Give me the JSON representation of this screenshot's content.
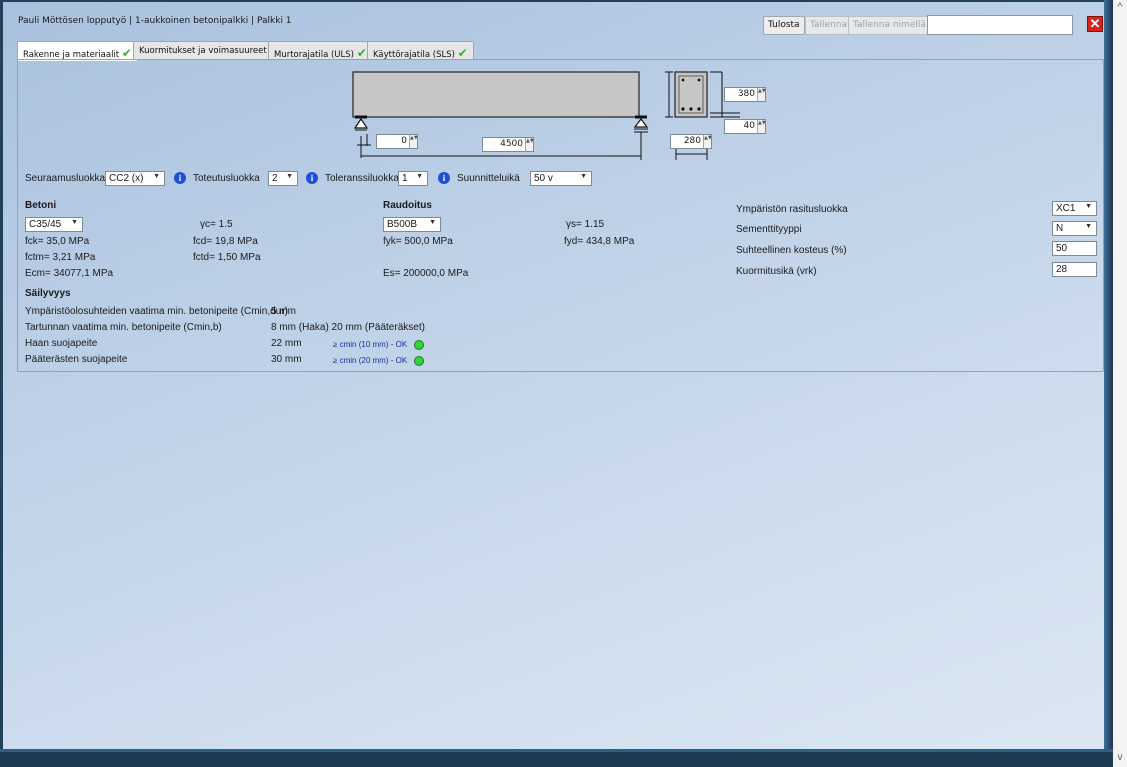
{
  "window": {
    "title": "Pauli Möttösen lopputyö | 1-aukkoinen betonipalkki | Palkki 1",
    "buttons": {
      "print": "Tulosta",
      "save": "Tallenna",
      "save_as": "Tallenna nimellä"
    },
    "search_value": "",
    "close_icon": "close-icon",
    "scroll_up": "^",
    "scroll_down": "v"
  },
  "tabs": [
    {
      "label": "Rakenne ja materiaalit",
      "status": "✔",
      "active": true
    },
    {
      "label": "Kuormitukset ja voimasuureet",
      "status": ""
    },
    {
      "label": "Murtorajatila (ULS)",
      "status": "✔"
    },
    {
      "label": "Käyttörajatila (SLS)",
      "status": "✔"
    }
  ],
  "geometry": {
    "support_offset": "0",
    "span": "4500",
    "section_width": "280",
    "section_height": "380",
    "cover": "40",
    "spin_arrows": "▲▼"
  },
  "classes": {
    "consequence_label": "Seuraamusluokka",
    "consequence_value": "CC2 (x)",
    "execution_label": "Toteutusluokka",
    "execution_value": "2",
    "tolerance_label": "Toleranssiluokka",
    "tolerance_value": "1",
    "design_life_label": "Suunnitteluikä",
    "design_life_value": "50 v",
    "info_glyph": "i",
    "dropdown_glyph": "▼"
  },
  "concrete": {
    "heading": "Betoni",
    "grade": "C35/45",
    "gamma_c": "γc=  1.5",
    "fck": "fck=   35,0 MPa",
    "fcd": "fcd=  19,8 MPa",
    "fctm": "fctm=  3,21 MPa",
    "fctd": "fctd=  1,50 MPa",
    "ecm": "Ecm=  34077,1 MPa"
  },
  "steel": {
    "heading": "Raudoitus",
    "grade": "B500B",
    "gamma_s": "γs=  1.15",
    "fyk": "fyk=  500,0 MPa",
    "fyd": "fyd=  434,8 MPa",
    "es": "Es=  200000,0 MPa"
  },
  "environment": {
    "exposure_label": "Ympäristön rasitusluokka",
    "exposure_value": "XC1",
    "cement_label": "Sementtityyppi",
    "cement_value": "N",
    "humidity_label": "Suhteellinen kosteus (%)",
    "humidity_value": "50",
    "age_label": "Kuormitusikä (vrk)",
    "age_value": "28"
  },
  "durability": {
    "heading": "Säilyvyys",
    "cmin_dur_label": "Ympäristöolosuhteiden vaatima min. betonipeite (Cmin,dur)",
    "cmin_dur_value": "5 mm",
    "cmin_b_label": "Tartunnan vaatima min. betonipeite (Cmin,b)",
    "cmin_b_value": "8 mm  (Haka)  20 mm  (Pääteräkset)",
    "stirrup_label": "Haan suojapeite",
    "stirrup_value": "22 mm",
    "stirrup_check": "≥ cmin (10 mm) - OK",
    "main_label": "Pääterästen suojapeite",
    "main_value": "30 mm",
    "main_check": "≥ cmin (20 mm) - OK",
    "status_color": "#33d33a"
  }
}
